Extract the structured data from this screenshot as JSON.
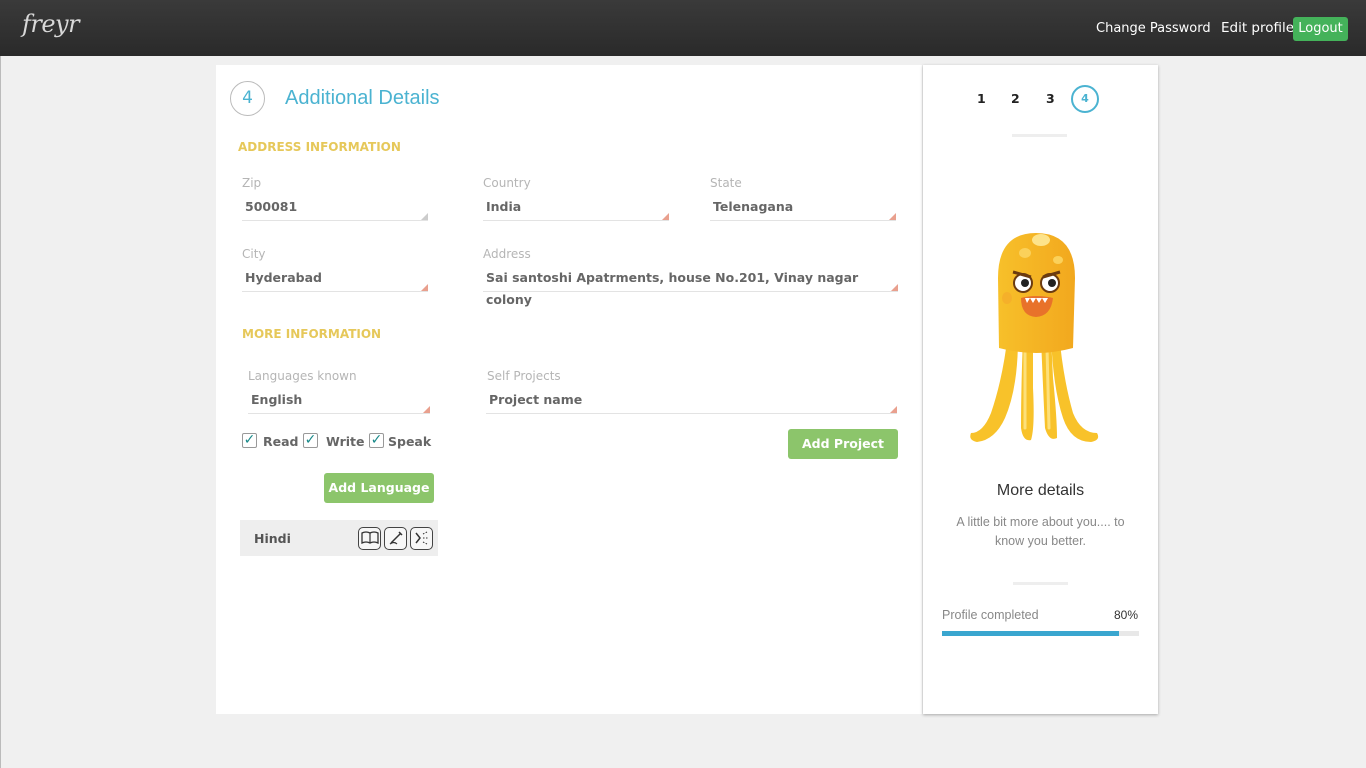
{
  "header": {
    "logo": "freyr",
    "change_password": "Change Password",
    "edit_profile": "Edit profile",
    "logout": "Logout"
  },
  "form": {
    "step_number": "4",
    "title": "Additional Details",
    "address_section": "ADDRESS INFORMATION",
    "zip": {
      "label": "Zip",
      "value": "500081"
    },
    "country": {
      "label": "Country",
      "value": "India"
    },
    "state": {
      "label": "State",
      "value": "Telenagana"
    },
    "city": {
      "label": "City",
      "value": "Hyderabad"
    },
    "address": {
      "label": "Address",
      "value": "Sai santoshi Apatrments, house No.201, Vinay nagar colony"
    },
    "more_section": "MORE INFORMATION",
    "languages": {
      "label": "Languages known",
      "value": "English"
    },
    "projects": {
      "label": "Self Projects",
      "placeholder": "Project name"
    },
    "checkboxes": [
      {
        "label": "Read",
        "checked": true
      },
      {
        "label": "Write",
        "checked": true
      },
      {
        "label": "Speak",
        "checked": true
      }
    ],
    "add_language": "Add Language",
    "add_project": "Add Project",
    "language_list": [
      {
        "name": "Hindi",
        "icons": [
          "read-book-icon",
          "write-pen-icon",
          "speak-icon"
        ]
      }
    ]
  },
  "sidebar": {
    "steps": [
      "1",
      "2",
      "3",
      "4"
    ],
    "current_step": "4",
    "more_title": "More details",
    "more_desc": "A little bit more about you.... to know you better.",
    "progress_label": "Profile completed",
    "progress_text": "80%",
    "progress_value": 0.8,
    "colors": {
      "accent": "#4bb3d1",
      "progress": "#3aa6cf",
      "button": "#8cc56b",
      "logout": "#44b25a"
    }
  }
}
